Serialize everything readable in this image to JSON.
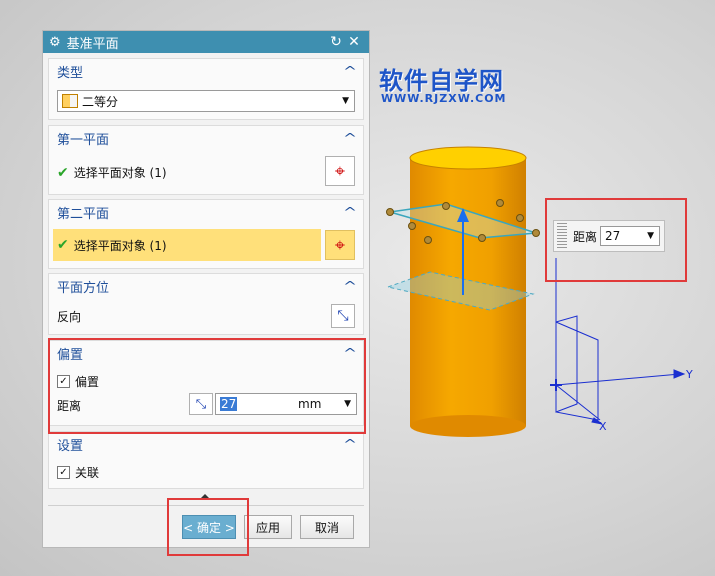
{
  "dialog": {
    "title": "基准平面",
    "sections": {
      "type": {
        "header": "类型",
        "select_value": "二等分"
      },
      "first_plane": {
        "header": "第一平面",
        "select_object": "选择平面对象 (1)"
      },
      "second_plane": {
        "header": "第二平面",
        "select_object": "选择平面对象 (1)"
      },
      "orientation": {
        "header": "平面方位",
        "reverse_label": "反向"
      },
      "offset": {
        "header": "偏置",
        "checkbox_label": "偏置",
        "distance_label": "距离",
        "distance_value": "27",
        "unit": "mm"
      },
      "settings": {
        "header": "设置",
        "associative_label": "关联"
      }
    },
    "buttons": {
      "ok": "< 确定 >",
      "apply": "应用",
      "cancel": "取消"
    }
  },
  "watermark": {
    "cn": "软件自学网",
    "url": "WWW.RJZXW.COM"
  },
  "float_input": {
    "label": "距离",
    "value": "27"
  },
  "axes": {
    "y_label": "Y",
    "x_label": "X"
  },
  "colors": {
    "title_bar": "#3e8fb0",
    "highlight_row": "#ffe07a",
    "cylinder": "#f0a000",
    "red_annotation": "#e03a3a"
  }
}
